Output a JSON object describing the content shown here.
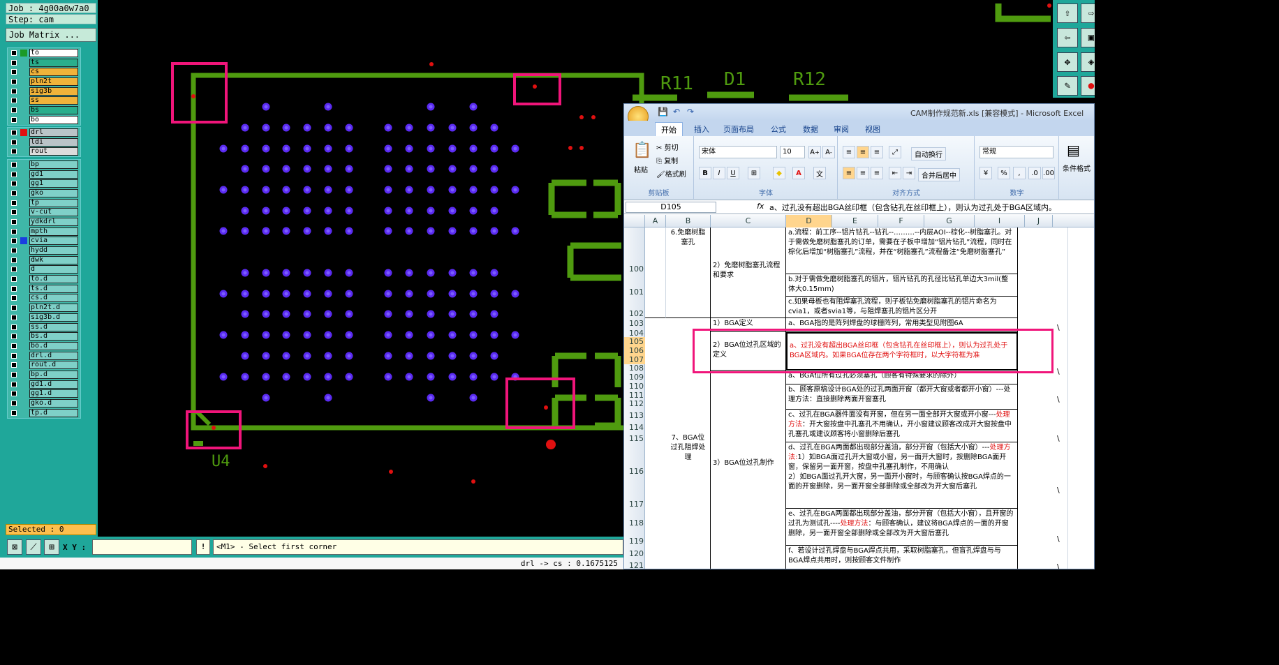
{
  "cam": {
    "job": "Job : 4g00a0w7a0",
    "step": "Step: cam",
    "job_matrix": "Job Matrix ...",
    "selected": "Selected : 0",
    "xy_label": "X Y :",
    "xy_value": "",
    "exclaim": "!",
    "prompt": "<M1> - Select first corner",
    "status": "drl -> cs : 0.1675125",
    "layers_group1": [
      {
        "name": "to",
        "color": "#ffffff",
        "swatch": "#1b9a28"
      },
      {
        "name": "ts",
        "color": "#2aae8c",
        "swatch": ""
      },
      {
        "name": "cs",
        "color": "#f0b33a",
        "swatch": ""
      },
      {
        "name": "pln2t",
        "color": "#f0b33a",
        "swatch": ""
      },
      {
        "name": "sig3b",
        "color": "#f0b33a",
        "swatch": ""
      },
      {
        "name": "ss",
        "color": "#f0b33a",
        "swatch": ""
      },
      {
        "name": "bs",
        "color": "#2aae8c",
        "swatch": ""
      },
      {
        "name": "bo",
        "color": "#ffffff",
        "swatch": ""
      }
    ],
    "layers_group2": [
      {
        "name": "drl",
        "color": "#b9c4c8",
        "swatch": "#e01010"
      },
      {
        "name": "ldi",
        "color": "#b9c4c8",
        "swatch": ""
      },
      {
        "name": "rout",
        "color": "#dcdcdc",
        "swatch": ""
      }
    ],
    "layers_group3": [
      {
        "name": "bp",
        "color": "#7fd0c8",
        "swatch": ""
      },
      {
        "name": "gd1",
        "color": "#7fd0c8",
        "swatch": ""
      },
      {
        "name": "gg1",
        "color": "#7fd0c8",
        "swatch": ""
      },
      {
        "name": "gko",
        "color": "#7fd0c8",
        "swatch": ""
      },
      {
        "name": "tp",
        "color": "#7fd0c8",
        "swatch": ""
      },
      {
        "name": "v-cut",
        "color": "#7fd0c8",
        "swatch": ""
      },
      {
        "name": "ydkdrl",
        "color": "#7fd0c8",
        "swatch": ""
      },
      {
        "name": "mpth",
        "color": "#7fd0c8",
        "swatch": ""
      },
      {
        "name": "cvia",
        "color": "#7fd0c8",
        "swatch": "#1a3fe0"
      },
      {
        "name": "hydd",
        "color": "#7fd0c8",
        "swatch": ""
      },
      {
        "name": "dwk",
        "color": "#7fd0c8",
        "swatch": ""
      },
      {
        "name": "d",
        "color": "#7fd0c8",
        "swatch": ""
      },
      {
        "name": "to.d",
        "color": "#7fd0c8",
        "swatch": ""
      },
      {
        "name": "ts.d",
        "color": "#7fd0c8",
        "swatch": ""
      },
      {
        "name": "cs.d",
        "color": "#7fd0c8",
        "swatch": ""
      },
      {
        "name": "pln2t.d",
        "color": "#7fd0c8",
        "swatch": ""
      },
      {
        "name": "sig3b.d",
        "color": "#7fd0c8",
        "swatch": ""
      },
      {
        "name": "ss.d",
        "color": "#7fd0c8",
        "swatch": ""
      },
      {
        "name": "bs.d",
        "color": "#7fd0c8",
        "swatch": ""
      },
      {
        "name": "bo.d",
        "color": "#7fd0c8",
        "swatch": ""
      },
      {
        "name": "drl.d",
        "color": "#7fd0c8",
        "swatch": ""
      },
      {
        "name": "rout.d",
        "color": "#7fd0c8",
        "swatch": ""
      },
      {
        "name": "bp.d",
        "color": "#7fd0c8",
        "swatch": ""
      },
      {
        "name": "gd1.d",
        "color": "#7fd0c8",
        "swatch": ""
      },
      {
        "name": "gg1.d",
        "color": "#7fd0c8",
        "swatch": ""
      },
      {
        "name": "gko.d",
        "color": "#7fd0c8",
        "swatch": ""
      },
      {
        "name": "tp.d",
        "color": "#7fd0c8",
        "swatch": ""
      }
    ],
    "silkscreen": {
      "u4": "U4",
      "r11": "R11",
      "d1": "D1",
      "r12": "R12"
    },
    "colors": {
      "outline": "#4f9b0f",
      "pad": "#5b2bf2",
      "pad_core": "#7a5cff",
      "drill": "#e01010",
      "highlight": "#f0157a"
    }
  },
  "excel": {
    "title": "CAM制作规范新.xls  [兼容模式]  -  Microsoft Excel",
    "tabs": [
      "开始",
      "插入",
      "页面布局",
      "公式",
      "数据",
      "审阅",
      "视图"
    ],
    "clipboard": {
      "paste": "粘贴",
      "cut": "剪切",
      "copy": "复制",
      "format_painter": "格式刷",
      "label": "剪贴板"
    },
    "font": {
      "name": "宋体",
      "size": "10",
      "label": "字体",
      "bold": "B",
      "italic": "I",
      "underline": "U"
    },
    "alignment": {
      "wrap": "自动换行",
      "merge": "合并后居中",
      "label": "对齐方式"
    },
    "number": {
      "format": "常规",
      "percent": "%",
      "comma": ",",
      "label": "数字"
    },
    "styles": {
      "cond": "条件格式"
    },
    "name_box": "D105",
    "fx": "fx",
    "formula": "a、过孔没有超出BGA丝印框（包含钻孔在丝印框上），则认为过孔处于BGA区域内。",
    "columns": [
      "A",
      "B",
      "C",
      "D",
      "E",
      "F",
      "G",
      "I",
      "J"
    ],
    "rows": [
      "100",
      "101",
      "102",
      "103",
      "104",
      "105",
      "106",
      "107",
      "108",
      "109",
      "110",
      "111",
      "112",
      "113",
      "114",
      "115",
      "116",
      "117",
      "118",
      "119",
      "120",
      "121"
    ],
    "cells": {
      "b_top": "6.免磨树脂塞孔",
      "c_100": "2）免磨树脂塞孔流程和要求",
      "d_100": "a.流程：前工序--铝片钻孔--钻孔--………--内层AOI--棕化--树脂塞孔。对于需做免磨树脂塞孔的订单，需要在子板中增加“铝片钻孔”流程，同时在棕化后增加“树脂塞孔”流程，并在“树脂塞孔”流程备注“免磨树脂塞孔”",
      "d_101": "b.对于需做免磨树脂塞孔的铝片，铝片钻孔的孔径比钻孔单边大3mil(整体大0.15mm)",
      "d_102": "c.如果母板也有阻焊塞孔流程，则子板钻免磨树脂塞孔的铝片命名为cvia1，或者svia1等，与阻焊塞孔的铝片区分开",
      "c_103": "1）BGA定义",
      "d_103": "a、BGA指的是阵列焊盘的球栅阵列，常用类型见附图6A",
      "c_105": "2）BGA位过孔区域的定义",
      "d_105": "a、过孔没有超出BGA丝印框（包含钻孔在丝印框上），则认为过孔处于BGA区域内。如果BGA位存在两个字符框时，以大字符框为准",
      "d_108": "a、BGA位所有过孔必须塞孔（顾客有特殊要求的除外）",
      "b_mid": "7、BGA位过孔阻焊处理",
      "c_mid": "3）BGA位过孔制作",
      "d_110": "b、顾客原稿设计BGA处的过孔两面开窗（都开大窗或者都开小窗）---处理方法：直接删除两面开窗塞孔",
      "d_113a": "c、过孔在BGA器件面没有开窗，但在另一面全部开大窗或开小窗---",
      "d_113b": "处理方法",
      "d_113c": "：开大窗按盘中孔塞孔不用确认，开小窗建议顾客改成开大窗按盘中孔塞孔或建议顾客将小窗删除后塞孔",
      "d_116a": "d、过孔在BGA两面都出现部分盖油，部分开窗（包括大小窗）---",
      "d_116b": "处理方法:",
      "d_116c": "1）如BGA面过孔开大窗或小窗，另一面开大窗时，按删除BGA面开窗，保留另一面开窗，按盘中孔塞孔制作，不用确认\n2）如BGA面过孔开大窗，另一面开小窗时，与顾客确认按BGA焊点的一面的开窗删除，另一面开窗全部删除或全部改为开大窗后塞孔",
      "d_118a": "e、过孔在BGA两面都出现部分盖油，部分开窗（包括大小窗），且开窗的过孔为测试孔----",
      "d_118b": "处理方法",
      "d_118c": "：与顾客确认，建议将BGA焊点的一面的开窗删除，另一面开窗全部删除或全部改为开大窗后塞孔",
      "d_120": "f、若设计过孔焊盘与BGA焊点共用，采取树脂塞孔，但盲孔焊盘与与BGA焊点共用时，则按顾客文件制作",
      "i_mark": "\\"
    }
  }
}
